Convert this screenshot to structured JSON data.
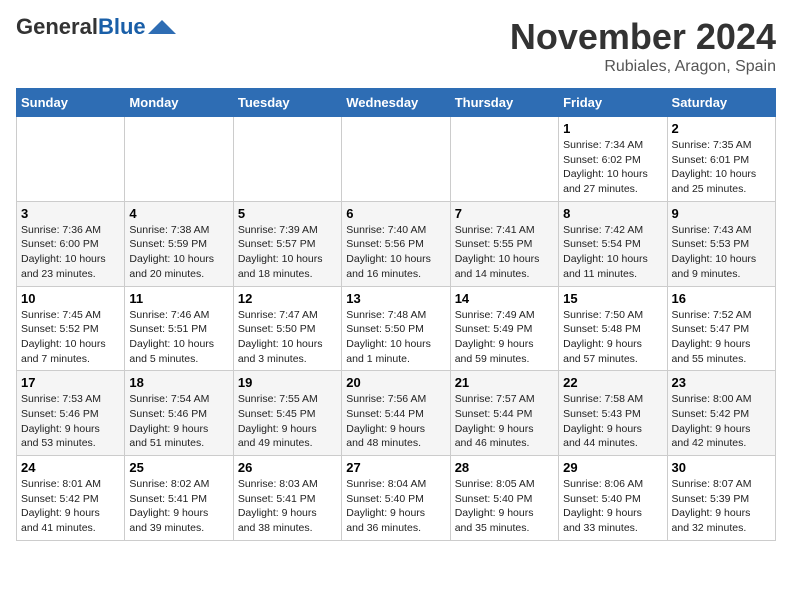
{
  "header": {
    "logo_general": "General",
    "logo_blue": "Blue",
    "month": "November 2024",
    "location": "Rubiales, Aragon, Spain"
  },
  "weekdays": [
    "Sunday",
    "Monday",
    "Tuesday",
    "Wednesday",
    "Thursday",
    "Friday",
    "Saturday"
  ],
  "weeks": [
    [
      {
        "day": "",
        "info": ""
      },
      {
        "day": "",
        "info": ""
      },
      {
        "day": "",
        "info": ""
      },
      {
        "day": "",
        "info": ""
      },
      {
        "day": "",
        "info": ""
      },
      {
        "day": "1",
        "info": "Sunrise: 7:34 AM\nSunset: 6:02 PM\nDaylight: 10 hours\nand 27 minutes."
      },
      {
        "day": "2",
        "info": "Sunrise: 7:35 AM\nSunset: 6:01 PM\nDaylight: 10 hours\nand 25 minutes."
      }
    ],
    [
      {
        "day": "3",
        "info": "Sunrise: 7:36 AM\nSunset: 6:00 PM\nDaylight: 10 hours\nand 23 minutes."
      },
      {
        "day": "4",
        "info": "Sunrise: 7:38 AM\nSunset: 5:59 PM\nDaylight: 10 hours\nand 20 minutes."
      },
      {
        "day": "5",
        "info": "Sunrise: 7:39 AM\nSunset: 5:57 PM\nDaylight: 10 hours\nand 18 minutes."
      },
      {
        "day": "6",
        "info": "Sunrise: 7:40 AM\nSunset: 5:56 PM\nDaylight: 10 hours\nand 16 minutes."
      },
      {
        "day": "7",
        "info": "Sunrise: 7:41 AM\nSunset: 5:55 PM\nDaylight: 10 hours\nand 14 minutes."
      },
      {
        "day": "8",
        "info": "Sunrise: 7:42 AM\nSunset: 5:54 PM\nDaylight: 10 hours\nand 11 minutes."
      },
      {
        "day": "9",
        "info": "Sunrise: 7:43 AM\nSunset: 5:53 PM\nDaylight: 10 hours\nand 9 minutes."
      }
    ],
    [
      {
        "day": "10",
        "info": "Sunrise: 7:45 AM\nSunset: 5:52 PM\nDaylight: 10 hours\nand 7 minutes."
      },
      {
        "day": "11",
        "info": "Sunrise: 7:46 AM\nSunset: 5:51 PM\nDaylight: 10 hours\nand 5 minutes."
      },
      {
        "day": "12",
        "info": "Sunrise: 7:47 AM\nSunset: 5:50 PM\nDaylight: 10 hours\nand 3 minutes."
      },
      {
        "day": "13",
        "info": "Sunrise: 7:48 AM\nSunset: 5:50 PM\nDaylight: 10 hours\nand 1 minute."
      },
      {
        "day": "14",
        "info": "Sunrise: 7:49 AM\nSunset: 5:49 PM\nDaylight: 9 hours\nand 59 minutes."
      },
      {
        "day": "15",
        "info": "Sunrise: 7:50 AM\nSunset: 5:48 PM\nDaylight: 9 hours\nand 57 minutes."
      },
      {
        "day": "16",
        "info": "Sunrise: 7:52 AM\nSunset: 5:47 PM\nDaylight: 9 hours\nand 55 minutes."
      }
    ],
    [
      {
        "day": "17",
        "info": "Sunrise: 7:53 AM\nSunset: 5:46 PM\nDaylight: 9 hours\nand 53 minutes."
      },
      {
        "day": "18",
        "info": "Sunrise: 7:54 AM\nSunset: 5:46 PM\nDaylight: 9 hours\nand 51 minutes."
      },
      {
        "day": "19",
        "info": "Sunrise: 7:55 AM\nSunset: 5:45 PM\nDaylight: 9 hours\nand 49 minutes."
      },
      {
        "day": "20",
        "info": "Sunrise: 7:56 AM\nSunset: 5:44 PM\nDaylight: 9 hours\nand 48 minutes."
      },
      {
        "day": "21",
        "info": "Sunrise: 7:57 AM\nSunset: 5:44 PM\nDaylight: 9 hours\nand 46 minutes."
      },
      {
        "day": "22",
        "info": "Sunrise: 7:58 AM\nSunset: 5:43 PM\nDaylight: 9 hours\nand 44 minutes."
      },
      {
        "day": "23",
        "info": "Sunrise: 8:00 AM\nSunset: 5:42 PM\nDaylight: 9 hours\nand 42 minutes."
      }
    ],
    [
      {
        "day": "24",
        "info": "Sunrise: 8:01 AM\nSunset: 5:42 PM\nDaylight: 9 hours\nand 41 minutes."
      },
      {
        "day": "25",
        "info": "Sunrise: 8:02 AM\nSunset: 5:41 PM\nDaylight: 9 hours\nand 39 minutes."
      },
      {
        "day": "26",
        "info": "Sunrise: 8:03 AM\nSunset: 5:41 PM\nDaylight: 9 hours\nand 38 minutes."
      },
      {
        "day": "27",
        "info": "Sunrise: 8:04 AM\nSunset: 5:40 PM\nDaylight: 9 hours\nand 36 minutes."
      },
      {
        "day": "28",
        "info": "Sunrise: 8:05 AM\nSunset: 5:40 PM\nDaylight: 9 hours\nand 35 minutes."
      },
      {
        "day": "29",
        "info": "Sunrise: 8:06 AM\nSunset: 5:40 PM\nDaylight: 9 hours\nand 33 minutes."
      },
      {
        "day": "30",
        "info": "Sunrise: 8:07 AM\nSunset: 5:39 PM\nDaylight: 9 hours\nand 32 minutes."
      }
    ]
  ]
}
